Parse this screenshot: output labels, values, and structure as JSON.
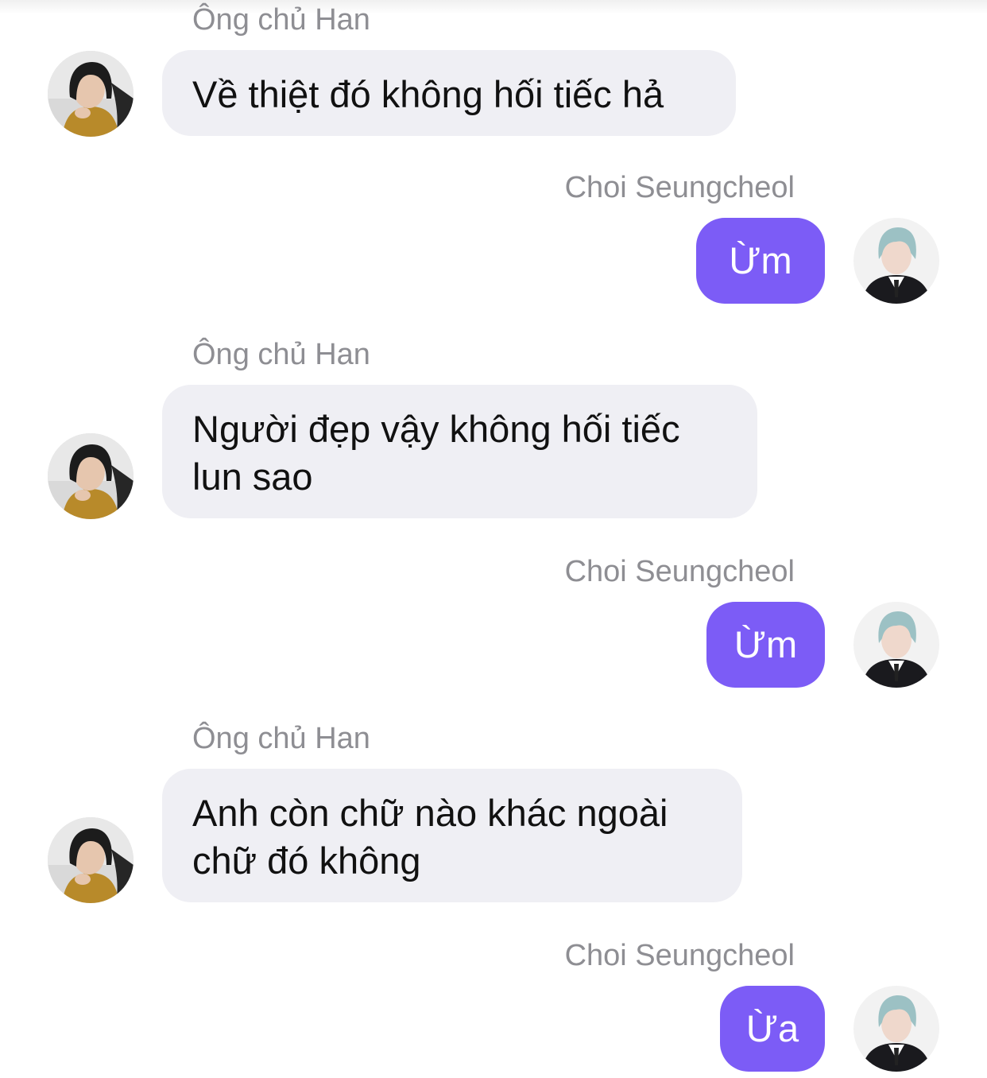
{
  "conversation": {
    "messages": [
      {
        "sender": "Ông chủ Han",
        "text": "Về thiệt đó không hối tiếc hả",
        "direction": "incoming"
      },
      {
        "sender": "Choi Seungcheol",
        "text": "Ừm",
        "direction": "outgoing"
      },
      {
        "sender": "Ông chủ Han",
        "text": "Người đẹp vậy không hối tiếc lun sao",
        "direction": "incoming"
      },
      {
        "sender": "Choi Seungcheol",
        "text": "Ừm",
        "direction": "outgoing"
      },
      {
        "sender": "Ông chủ Han",
        "text": "Anh còn chữ nào khác ngoài chữ đó không",
        "direction": "incoming"
      },
      {
        "sender": "Choi Seungcheol",
        "text": "Ừa",
        "direction": "outgoing"
      }
    ]
  },
  "colors": {
    "incoming_bubble": "#efeff4",
    "outgoing_bubble": "#7c5cf6",
    "sender_label": "#8e8e93"
  }
}
